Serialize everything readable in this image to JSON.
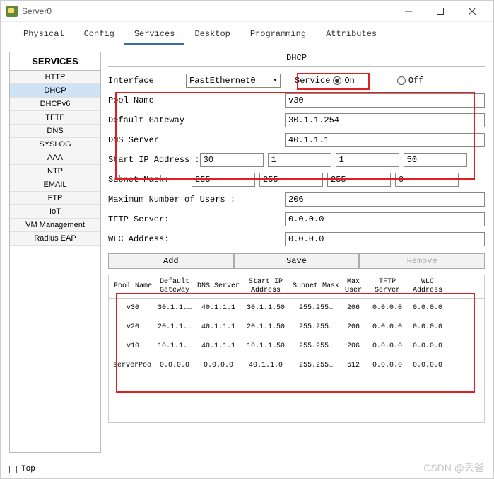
{
  "titlebar": {
    "title": "Server0"
  },
  "tabs": {
    "physical": "Physical",
    "config": "Config",
    "services": "Services",
    "desktop": "Desktop",
    "programming": "Programming",
    "attributes": "Attributes"
  },
  "sidebar": {
    "header": "SERVICES",
    "items": [
      "HTTP",
      "DHCP",
      "DHCPv6",
      "TFTP",
      "DNS",
      "SYSLOG",
      "AAA",
      "NTP",
      "EMAIL",
      "FTP",
      "IoT",
      "VM Management",
      "Radius EAP"
    ]
  },
  "page": {
    "title": "DHCP",
    "interface_label": "Interface",
    "interface_value": "FastEthernet0",
    "service_label": "Service",
    "on_label": "On",
    "off_label": "Off",
    "pool_name_label": "Pool Name",
    "pool_name_value": "v30",
    "default_gw_label": "Default Gateway",
    "default_gw_value": "30.1.1.254",
    "dns_label": "DNS Server",
    "dns_value": "40.1.1.1",
    "start_ip_label": "Start IP Address :",
    "start_ip": {
      "o1": "30",
      "o2": "1",
      "o3": "1",
      "o4": "50"
    },
    "subnet_label": "Subnet Mask:",
    "subnet": {
      "o1": "255",
      "o2": "255",
      "o3": "255",
      "o4": "0"
    },
    "max_users_label": "Maximum Number of Users :",
    "max_users_value": "206",
    "tftp_label": "TFTP Server:",
    "tftp_value": "0.0.0.0",
    "wlc_label": "WLC Address:",
    "wlc_value": "0.0.0.0",
    "buttons": {
      "add": "Add",
      "save": "Save",
      "remove": "Remove"
    }
  },
  "table": {
    "headers": {
      "pool": "Pool Name",
      "gw": "Default Gateway",
      "dns": "DNS Server",
      "start": "Start IP Address",
      "mask": "Subnet Mask",
      "max": "Max User",
      "tftp": "TFTP Server",
      "wlc": "WLC Address"
    },
    "rows": [
      {
        "pool": "v30",
        "gw": "30.1.1.…",
        "dns": "40.1.1.1",
        "start": "30.1.1.50",
        "mask": "255.255…",
        "max": "206",
        "tftp": "0.0.0.0",
        "wlc": "0.0.0.0"
      },
      {
        "pool": "v20",
        "gw": "20.1.1.…",
        "dns": "40.1.1.1",
        "start": "20.1.1.50",
        "mask": "255.255…",
        "max": "206",
        "tftp": "0.0.0.0",
        "wlc": "0.0.0.0"
      },
      {
        "pool": "v10",
        "gw": "10.1.1.…",
        "dns": "40.1.1.1",
        "start": "10.1.1.50",
        "mask": "255.255…",
        "max": "206",
        "tftp": "0.0.0.0",
        "wlc": "0.0.0.0"
      },
      {
        "pool": "serverPool",
        "gw": "0.0.0.0",
        "dns": "0.0.0.0",
        "start": "40.1.1.0",
        "mask": "255.255…",
        "max": "512",
        "tftp": "0.0.0.0",
        "wlc": "0.0.0.0"
      }
    ]
  },
  "footer": {
    "top": "Top"
  },
  "watermark": "CSDN @丢爸"
}
